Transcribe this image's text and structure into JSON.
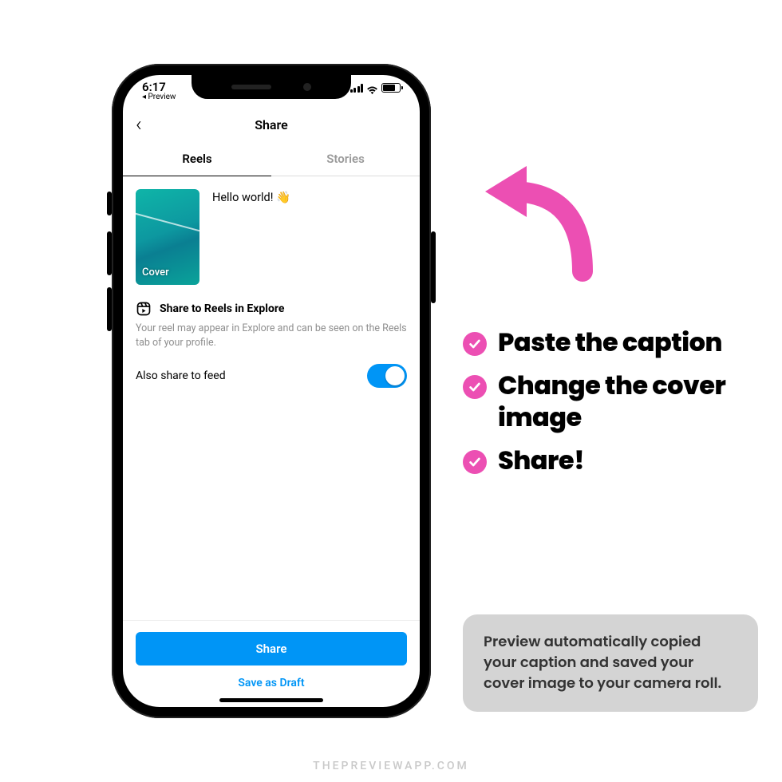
{
  "status_bar": {
    "time": "6:17",
    "back_app_label": "◂ Preview"
  },
  "header": {
    "title": "Share"
  },
  "tabs": {
    "reels": "Reels",
    "stories": "Stories"
  },
  "cover": {
    "label": "Cover",
    "caption": "Hello world! 👋"
  },
  "share_section": {
    "title": "Share to Reels in Explore",
    "description": "Your reel may appear in Explore and can be seen on the Reels tab of your profile.",
    "also_feed_label": "Also share to feed"
  },
  "buttons": {
    "share": "Share",
    "draft": "Save as Draft"
  },
  "bullets": [
    "Paste the caption",
    "Change the cover image",
    "Share!"
  ],
  "info_box": "Preview automatically copied your caption and saved your cover image to your camera roll.",
  "watermark": "THEPREVIEWAPP.COM",
  "colors": {
    "pink": "#ec4fb3",
    "ig_blue": "#0095f6"
  }
}
